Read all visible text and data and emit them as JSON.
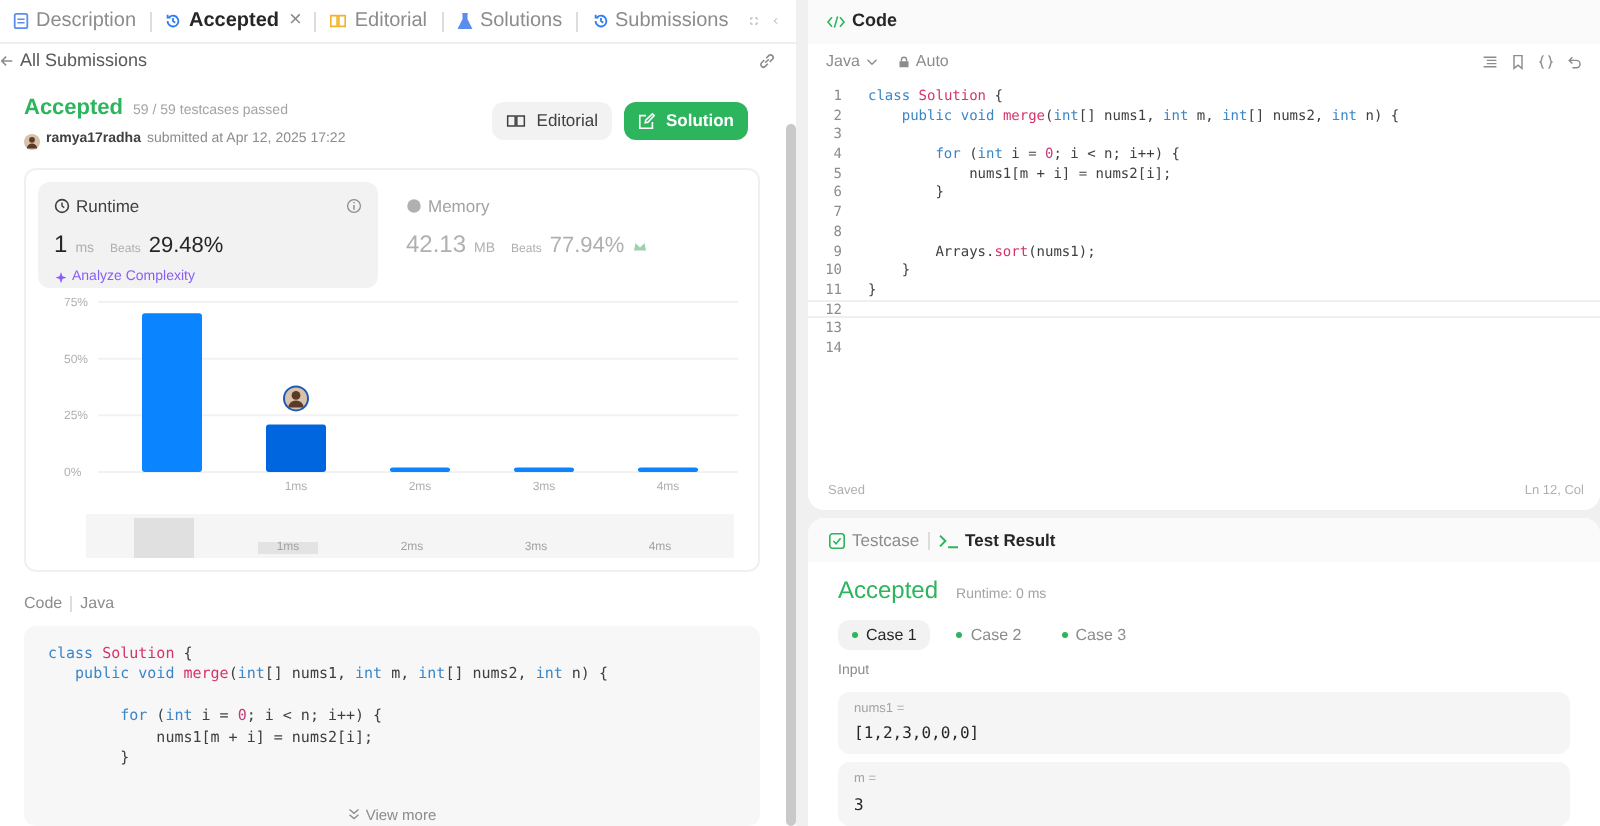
{
  "left_tabs": [
    {
      "label": "Description",
      "selected": false
    },
    {
      "label": "Accepted",
      "selected": true,
      "close": "×"
    },
    {
      "label": "Editorial",
      "selected": false
    },
    {
      "label": "Solutions",
      "selected": false
    },
    {
      "label": "Submissions",
      "selected": false
    }
  ],
  "back_link": "All Submissions",
  "submission": {
    "status": "Accepted",
    "testcases": "59 / 59 testcases passed",
    "user": "ramya17radha",
    "submitted": "submitted at Apr 12, 2025 17:22",
    "buttons": [
      {
        "label": "Editorial",
        "kind": "secondary"
      },
      {
        "label": "Solution",
        "kind": "primary"
      }
    ]
  },
  "metrics": [
    {
      "title": "Runtime",
      "value": "1",
      "unit": "ms",
      "beats_label": "Beats",
      "beats": "29.48%",
      "selected": true,
      "link": "Analyze Complexity"
    },
    {
      "title": "Memory",
      "value": "42.13",
      "unit": "MB",
      "beats_label": "Beats",
      "beats": "77.94%",
      "selected": false
    }
  ],
  "chart_data": {
    "type": "bar",
    "categories": [
      null,
      "1ms",
      "2ms",
      "3ms",
      "4ms"
    ],
    "series": [
      {
        "color": "#0a84ff",
        "values": [
          70,
          null,
          2,
          2,
          2
        ]
      },
      {
        "color": "#0066e0",
        "values": [
          null,
          21,
          null,
          null,
          null
        ]
      }
    ],
    "ylim": [
      0,
      75
    ],
    "yticks": [
      {
        "value": 0,
        "label": "0%"
      },
      {
        "value": 25,
        "label": "25%"
      },
      {
        "value": 50,
        "label": "50%"
      },
      {
        "value": 75,
        "label": "75%"
      }
    ]
  },
  "chart_navigator": {
    "labels": [
      "1ms",
      "2ms",
      "3ms",
      "4ms"
    ]
  },
  "code_header": {
    "title": "Code",
    "language": "Java"
  },
  "code_snippet": [
    {
      "tokens": [
        {
          "kind": "kw",
          "text": "class "
        },
        {
          "kind": "cls",
          "text": "Solution"
        },
        {
          "kind": "p",
          "text": " {"
        }
      ]
    },
    {
      "tokens": [
        {
          "kind": "kw",
          "text": "   public void "
        },
        {
          "kind": "fn",
          "text": "merge"
        },
        {
          "kind": "p",
          "text": "("
        },
        {
          "kind": "kw",
          "text": "int"
        },
        {
          "kind": "p",
          "text": "[] nums1, "
        },
        {
          "kind": "kw",
          "text": "int"
        },
        {
          "kind": "p",
          "text": " m, "
        },
        {
          "kind": "kw",
          "text": "int"
        },
        {
          "kind": "p",
          "text": "[] nums2, "
        },
        {
          "kind": "kw",
          "text": "int"
        },
        {
          "kind": "p",
          "text": " n) {"
        }
      ]
    },
    {
      "kind": "blank"
    },
    {
      "tokens": [
        {
          "kind": "kw",
          "text": "        for"
        },
        {
          "kind": "p",
          "text": " ("
        },
        {
          "kind": "kw",
          "text": "int"
        },
        {
          "kind": "p",
          "text": " i = "
        },
        {
          "kind": "num",
          "text": "0"
        },
        {
          "kind": "p",
          "text": "; i < n; i++) {"
        }
      ]
    },
    {
      "tokens": [
        {
          "kind": "p",
          "text": "            nums1[m + i] = nums2[i];"
        }
      ]
    },
    {
      "tokens": [
        {
          "kind": "p",
          "text": "        }"
        }
      ]
    }
  ],
  "view_more": "View more",
  "editor": {
    "title": "Code",
    "language": "Java",
    "mode": "Auto",
    "status": "Saved",
    "cursor": "Ln 12, Col",
    "lines": [
      {
        "number": "1",
        "tokens": [
          {
            "kind": "kw",
            "text": "class "
          },
          {
            "kind": "cls",
            "text": "Solution"
          },
          {
            "kind": "p",
            "text": " {"
          }
        ]
      },
      {
        "number": "2",
        "tokens": [
          {
            "kind": "kw",
            "text": "    public void "
          },
          {
            "kind": "fn",
            "text": "merge"
          },
          {
            "kind": "p",
            "text": "("
          },
          {
            "kind": "kw",
            "text": "int"
          },
          {
            "kind": "p",
            "text": "[] nums1, "
          },
          {
            "kind": "kw",
            "text": "int"
          },
          {
            "kind": "p",
            "text": " m, "
          },
          {
            "kind": "kw",
            "text": "int"
          },
          {
            "kind": "p",
            "text": "[] nums2, "
          },
          {
            "kind": "kw",
            "text": "int"
          },
          {
            "kind": "p",
            "text": " n) {"
          }
        ]
      },
      {
        "number": "3"
      },
      {
        "number": "4",
        "tokens": [
          {
            "kind": "kw",
            "text": "        for"
          },
          {
            "kind": "p",
            "text": " ("
          },
          {
            "kind": "kw",
            "text": "int"
          },
          {
            "kind": "p",
            "text": " i = "
          },
          {
            "kind": "num",
            "text": "0"
          },
          {
            "kind": "p",
            "text": "; i < n; i++) {"
          }
        ]
      },
      {
        "number": "5",
        "tokens": [
          {
            "kind": "p",
            "text": "            nums1[m + i] = nums2[i];"
          }
        ]
      },
      {
        "number": "6",
        "tokens": [
          {
            "kind": "p",
            "text": "        }"
          }
        ]
      },
      {
        "number": "7"
      },
      {
        "number": "8"
      },
      {
        "number": "9",
        "tokens": [
          {
            "kind": "p",
            "text": "        Arrays."
          },
          {
            "kind": "fn",
            "text": "sort"
          },
          {
            "kind": "p",
            "text": "(nums1);"
          }
        ]
      },
      {
        "number": "10",
        "tokens": [
          {
            "kind": "p",
            "text": "    }"
          }
        ]
      },
      {
        "number": "11",
        "tokens": [
          {
            "kind": "p",
            "text": "}"
          }
        ]
      },
      {
        "number": "12",
        "current": true
      },
      {
        "number": "13"
      },
      {
        "number": "14"
      }
    ]
  },
  "result_tabs": [
    {
      "label": "Testcase",
      "selected": false
    },
    {
      "label": "Test Result",
      "selected": true
    }
  ],
  "result": {
    "status": "Accepted",
    "runtime": "Runtime: 0 ms",
    "cases": [
      {
        "label": "Case 1",
        "selected": true,
        "passed": true
      },
      {
        "label": "Case 2",
        "selected": false,
        "passed": true
      },
      {
        "label": "Case 3",
        "selected": false,
        "passed": true
      }
    ],
    "input_label": "Input",
    "inputs": [
      {
        "name": "nums1 =",
        "value": "[1,2,3,0,0,0]"
      },
      {
        "name": "m =",
        "value": "3"
      }
    ]
  }
}
